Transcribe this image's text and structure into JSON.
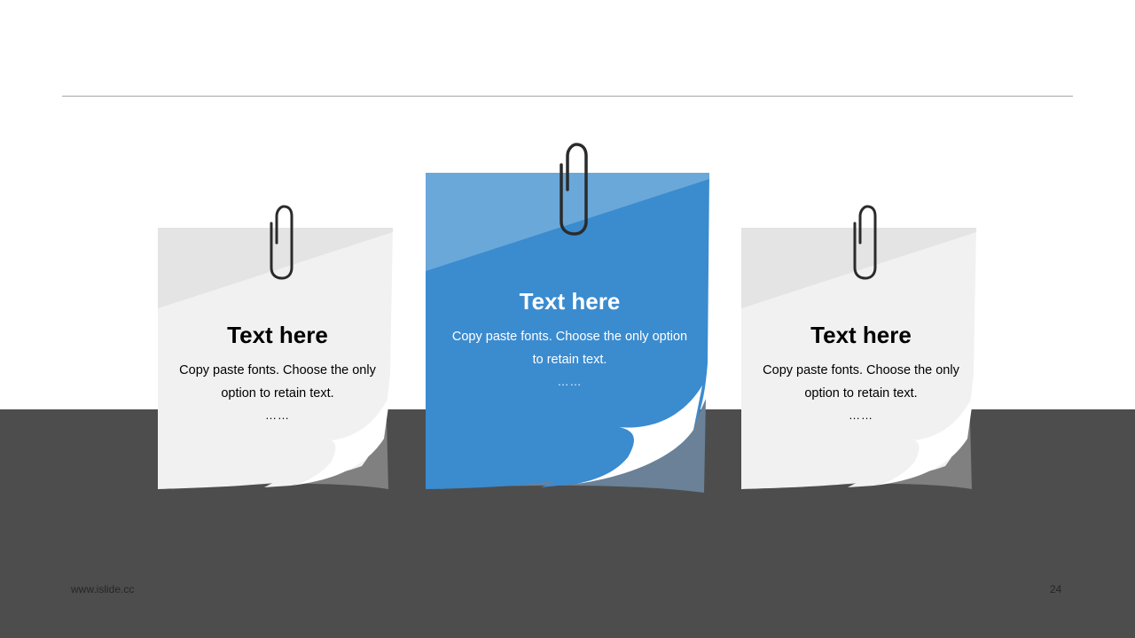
{
  "cards": [
    {
      "title": "Text here",
      "body": "Copy paste fonts. Choose the only option to retain text.",
      "ellipsis": "……",
      "color": "#f1f1f1"
    },
    {
      "title": "Text here",
      "body": "Copy paste fonts. Choose the only option to retain text.",
      "ellipsis": "……",
      "color": "#3b8bcf"
    },
    {
      "title": "Text here",
      "body": "Copy paste fonts. Choose the only option to retain text.",
      "ellipsis": "……",
      "color": "#f1f1f1"
    }
  ],
  "footer": {
    "website": "www.islide.cc",
    "page_number": "24"
  },
  "colors": {
    "floor": "#4d4d4d",
    "rule": "#a6a6a6",
    "accent_blue": "#3b8bcf"
  },
  "icons": [
    "paperclip-icon"
  ]
}
